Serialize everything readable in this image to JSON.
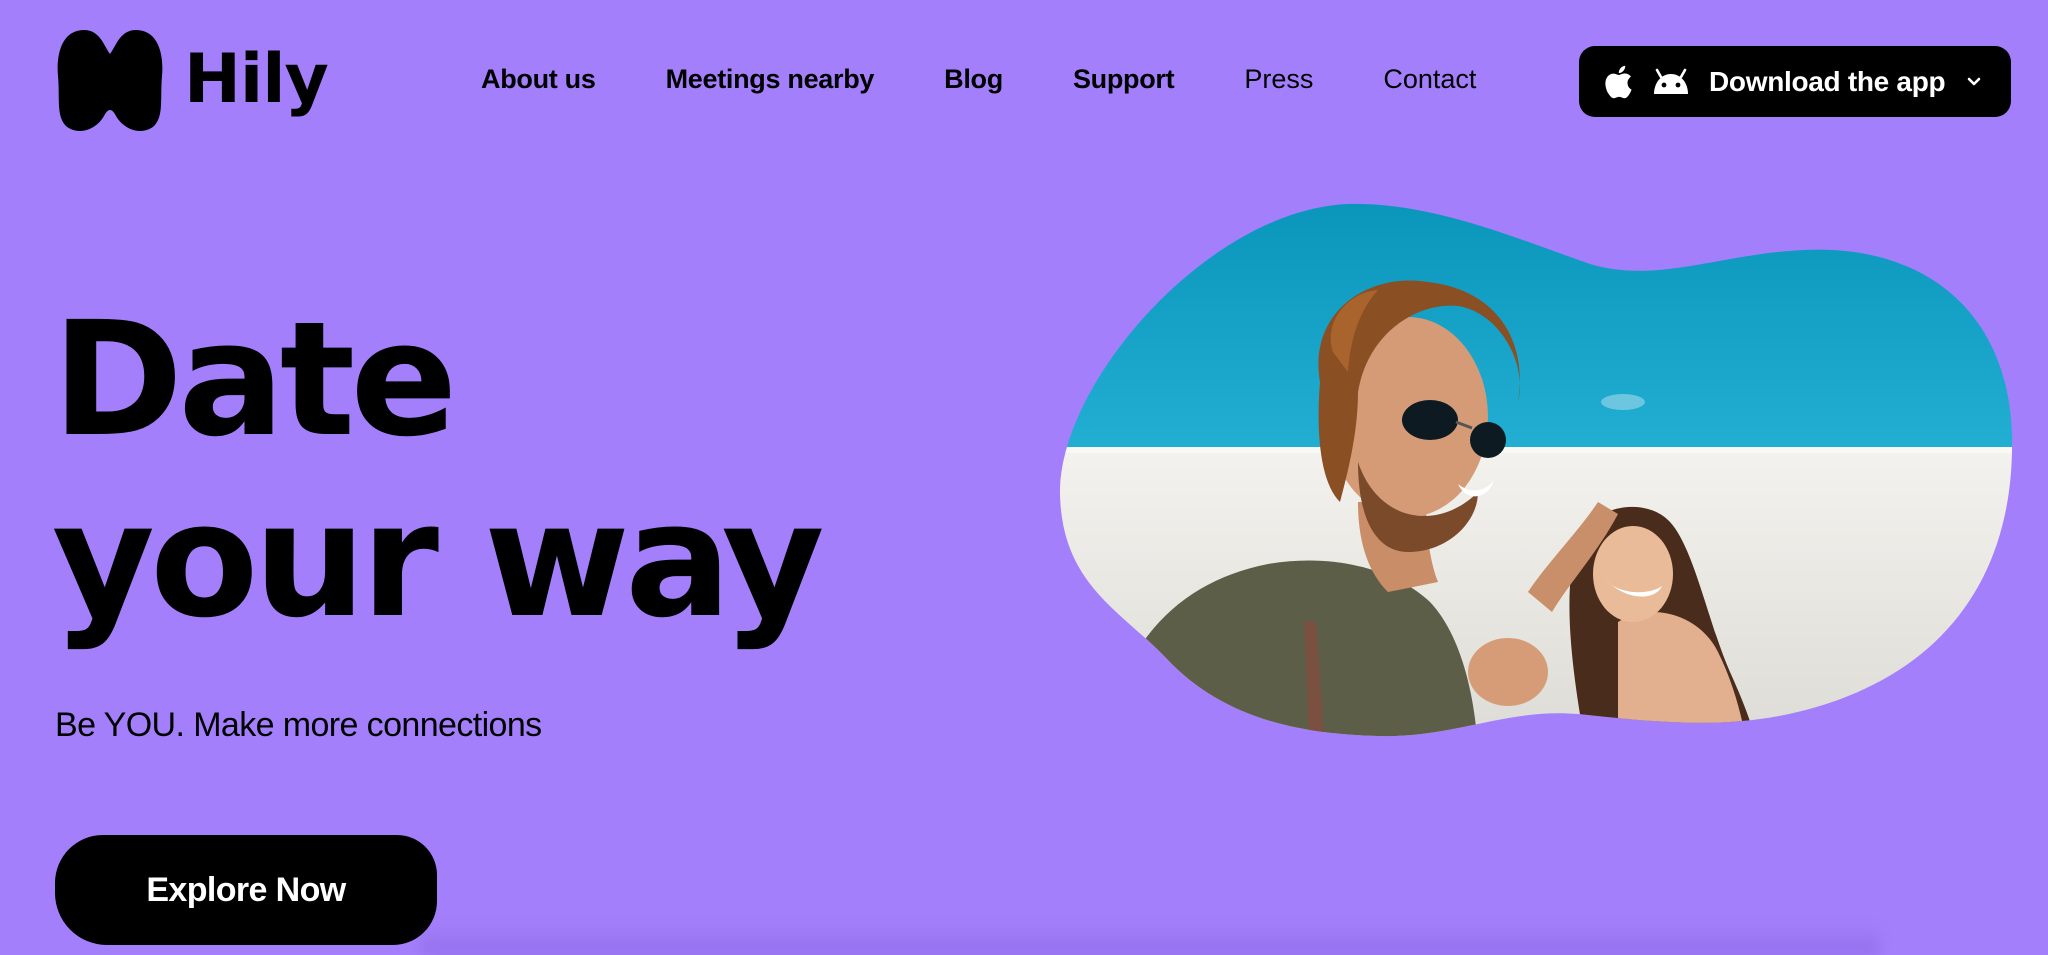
{
  "brand": {
    "name": "Hily",
    "icon": "hily-blob-logo-icon"
  },
  "nav": {
    "items": [
      {
        "label": "About us",
        "weight": "bold"
      },
      {
        "label": "Meetings nearby",
        "weight": "bold"
      },
      {
        "label": "Blog",
        "weight": "bold"
      },
      {
        "label": "Support",
        "weight": "bold"
      },
      {
        "label": "Press",
        "weight": "regular"
      },
      {
        "label": "Contact",
        "weight": "regular"
      }
    ]
  },
  "download": {
    "label": "Download the app",
    "icons": [
      "apple-icon",
      "android-icon",
      "chevron-down-icon"
    ]
  },
  "hero": {
    "headline_line1": "Date",
    "headline_line2": "your way",
    "tagline": "Be YOU. Make more connections",
    "cta_label": "Explore Now",
    "image": "couple-laughing-photo"
  },
  "colors": {
    "background": "#a47ffb",
    "button": "#000000",
    "button_text": "#ffffff",
    "sky": "#1aa3c8",
    "wall": "#ecebe6"
  }
}
